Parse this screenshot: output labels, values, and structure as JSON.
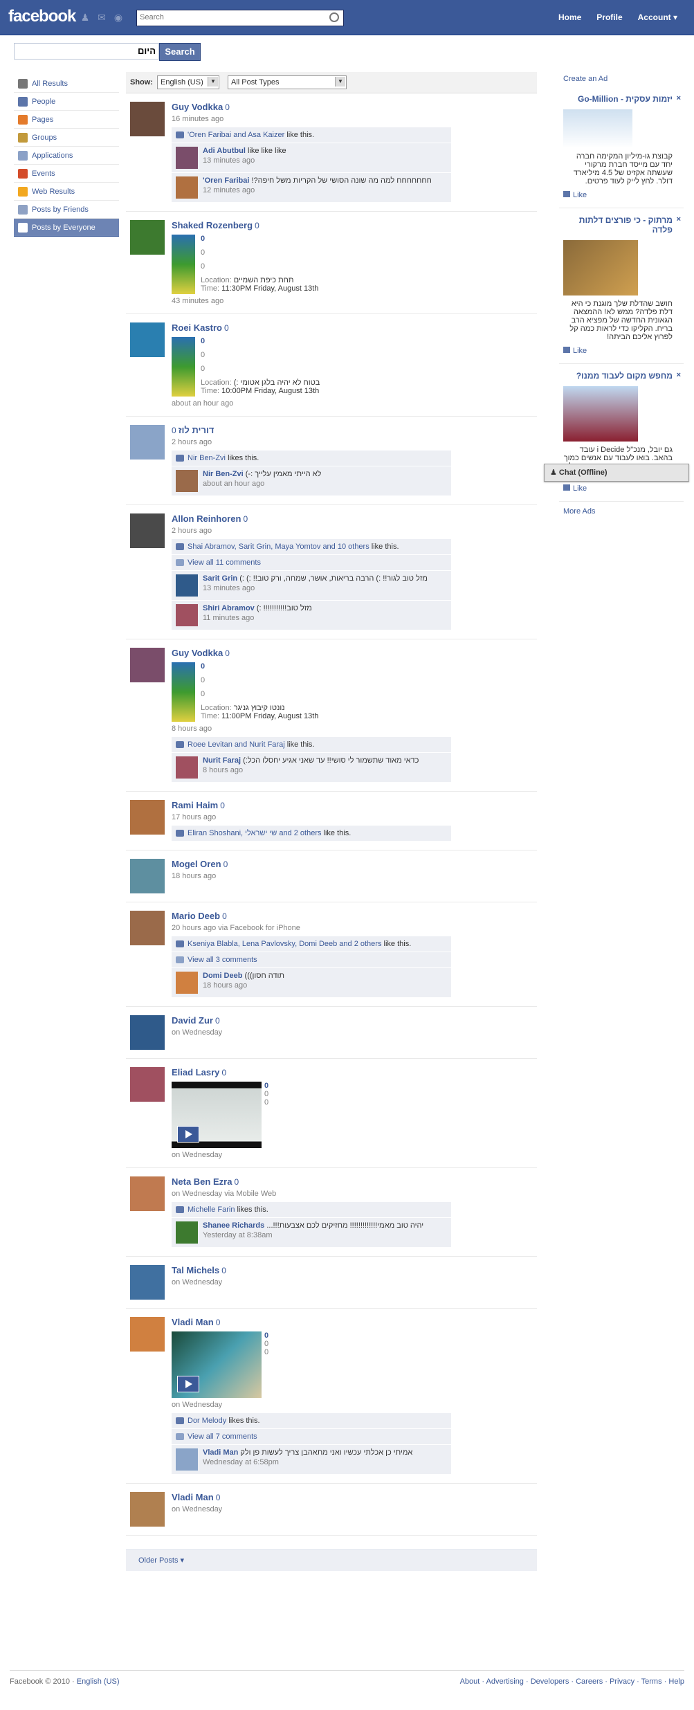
{
  "topbar": {
    "logo": "facebook",
    "search_placeholder": "Search",
    "nav": [
      "Home",
      "Profile",
      "Account ▾"
    ]
  },
  "query": {
    "value": "היום",
    "button": "Search"
  },
  "filters": [
    {
      "label": "All Results",
      "icon": "magnifier-icon",
      "color": "#777777"
    },
    {
      "label": "People",
      "icon": "person-icon",
      "color": "#5c75a9"
    },
    {
      "label": "Pages",
      "icon": "flag-icon",
      "color": "#e47b2c"
    },
    {
      "label": "Groups",
      "icon": "group-icon",
      "color": "#c29a3c"
    },
    {
      "label": "Applications",
      "icon": "puzzle-icon",
      "color": "#8ba1c7"
    },
    {
      "label": "Events",
      "icon": "calendar-icon",
      "color": "#d44c2a"
    },
    {
      "label": "Web Results",
      "icon": "web-icon",
      "color": "#f2a820"
    },
    {
      "label": "Posts by Friends",
      "icon": "posts-icon",
      "color": "#8fa2c4"
    },
    {
      "label": "Posts by Everyone",
      "icon": "posts-icon",
      "color": "#ffffff",
      "active": true
    }
  ],
  "show": {
    "label": "Show:",
    "lang": "English (US)",
    "type": "All Post Types"
  },
  "stories": [
    {
      "actor": "Guy Vodkka",
      "zero": "0",
      "time": "16 minutes ago",
      "likes": {
        "names": "'Oren Faribai and Asa Kaizer",
        "suffix": "like this."
      },
      "comments": [
        {
          "name": "Adi Abutbul",
          "text": "like like like",
          "time": "13 minutes ago"
        },
        {
          "name": "'Oren Faribai",
          "text": "חחחחחחח למה מה שונה הסושי של הקריות משל חיפה?!",
          "time": "12 minutes ago"
        }
      ]
    },
    {
      "actor": "Shaked Rozenberg",
      "zero": "0",
      "attach": {
        "n1": "0",
        "n2": "0",
        "n3": "0",
        "loc_label": "Location:",
        "loc": "תחת כיפת השמיים",
        "time_label": "Time:",
        "time": "11:30PM Friday, August 13th"
      },
      "time": "43 minutes ago"
    },
    {
      "actor": "Roei Kastro",
      "zero": "0",
      "attach": {
        "n1": "0",
        "n2": "0",
        "n3": "0",
        "loc_label": "Location:",
        "loc": "בטוח לא יהיה בלגן אטומי :)",
        "time_label": "Time:",
        "time": "10:00PM Friday, August 13th"
      },
      "time": "about an hour ago"
    },
    {
      "actor": "דורית לוז",
      "zero": "0",
      "time": "2 hours ago",
      "likes": {
        "names": "Nir Ben-Zvi",
        "suffix": "likes this."
      },
      "comments": [
        {
          "name": "Nir Ben-Zvi",
          "text": "לא הייתי מאמין עלייך :-)",
          "time": "about an hour ago"
        }
      ]
    },
    {
      "actor": "Allon Reinhoren",
      "zero": "0",
      "time": "2 hours ago",
      "likes": {
        "names": "Shai Abramov, Sarit Grin, Maya Yomtov and 10 others",
        "suffix": "like this."
      },
      "view_all": "View all 11 comments",
      "comments": [
        {
          "name": "Sarit Grin",
          "text": "מזל טוב לגור!! :) הרבה בריאות, אושר, שמחה, ורק טוב!! :) :)",
          "time": "13 minutes ago"
        },
        {
          "name": "Shiri Abramov",
          "text": "מזל טוב!!!!!!!!!!! :)",
          "time": "11 minutes ago"
        }
      ]
    },
    {
      "actor": "Guy Vodkka",
      "zero": "0",
      "attach": {
        "n1": "0",
        "n2": "0",
        "n3": "0",
        "loc_label": "Location:",
        "loc": "נונטו קיבוץ גניגר",
        "time_label": "Time:",
        "time": "11:00PM Friday, August 13th"
      },
      "time": "8 hours ago",
      "likes": {
        "names": "Roee Levitan and Nurit Faraj",
        "suffix": "like this."
      },
      "comments": [
        {
          "name": "Nurit Faraj",
          "text": "כדאי מאוד שתשמור לי סושי!! עד שאני אגיע יחסלו הכל:)",
          "time": "8 hours ago"
        }
      ]
    },
    {
      "actor": "Rami Haim",
      "zero": "0",
      "time": "17 hours ago",
      "likes": {
        "names": "Eliran Shoshani, שי ישראלי and 2 others",
        "suffix": "like this."
      }
    },
    {
      "actor": "Mogel Oren",
      "zero": "0",
      "time": "18 hours ago"
    },
    {
      "actor": "Mario Deeb",
      "zero": "0",
      "time": "20 hours ago via Facebook for iPhone",
      "likes": {
        "names": "Kseniya Blabla, Lena Pavlovsky, Domi Deeb and 2 others",
        "suffix": "like this."
      },
      "view_all": "View all 3 comments",
      "comments": [
        {
          "name": "Domi Deeb",
          "text": "תודה חסון)))",
          "time": "18 hours ago"
        }
      ]
    },
    {
      "actor": "David Zur",
      "zero": "0",
      "time": "on Wednesday"
    },
    {
      "actor": "Eliad Lasry",
      "zero": "0",
      "video": {
        "n1": "0",
        "n2": "0",
        "n3": "0"
      },
      "time": "on Wednesday"
    },
    {
      "actor": "Neta Ben Ezra",
      "zero": "0",
      "time": "on Wednesday via Mobile Web",
      "likes": {
        "names": "Michelle Farin",
        "suffix": "likes this."
      },
      "comments": [
        {
          "name": "Shanee Richards",
          "text": "יהיה טוב מאמי!!!!!!!!!!!!! מחזיקים לכם אצבעות!!!...",
          "time": "Yesterday at 8:38am"
        }
      ]
    },
    {
      "actor": "Tal Michels",
      "zero": "0",
      "time": "on Wednesday"
    },
    {
      "actor": "Vladi Man",
      "zero": "0",
      "video": {
        "n1": "0",
        "n2": "0",
        "n3": "0"
      },
      "time": "on Wednesday",
      "likes": {
        "names": "Dor Melody",
        "suffix": "likes this."
      },
      "view_all": "View all 7 comments",
      "comments": [
        {
          "name": "Vladi Man",
          "text": "אמיתי כן אכלתי עכשיו ואני מתאהבן צריך לעשות פן ולק",
          "time": "Wednesday at 6:58pm"
        }
      ]
    },
    {
      "actor": "Vladi Man",
      "zero": "0",
      "time": "on Wednesday"
    }
  ],
  "older": "Older Posts ▾",
  "right": {
    "create_ad": "Create an Ad",
    "ads": [
      {
        "title": "יזמות עסקית - Go-Million",
        "text": "קבוצת גו-מיליון המקימה חברה יחד עם מייסד חברת מרקורי שעשתה אקזיט של 4.5 מיליארד דולר. לחץ לייק לעוד פרטים.",
        "like": "Like"
      },
      {
        "title": "מרתוק - כי פורצים דלתות פלדה",
        "text": "חושב שהדלת שלך מוגנת כי היא דלת פלדה? ממש לא! ההמצאה הגאונית החדשה של מפציא הרב בריח. הקליקו כדי לראות כמה קל לפרוץ אליכם הביתה!",
        "like": "Like"
      },
      {
        "title": "מחפש מקום לעבוד ממנו?",
        "text": "גם יובל, מנכ\"ל i Decide עובד בהאב. בואו לעבוד עם אנשים כמוך במרחב עבודה משותף במרכז תל אביב.",
        "like": "Like"
      }
    ],
    "more_ads": "More Ads"
  },
  "chat": "Chat (Offline)",
  "footer": {
    "left": "Facebook © 2010 · ",
    "lang": "English (US)",
    "links": "About · Advertising · Developers · Careers · Privacy · Terms · Help"
  }
}
